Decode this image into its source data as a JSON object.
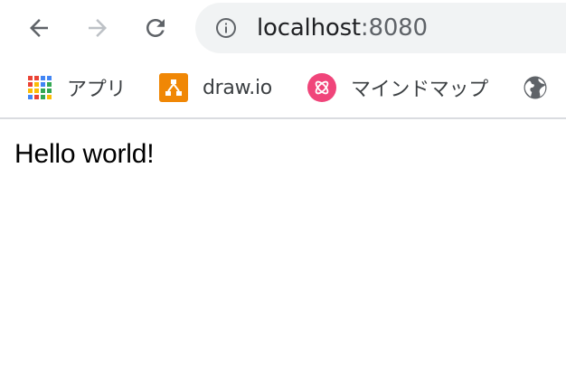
{
  "address_bar": {
    "host": "localhost",
    "port": ":8080"
  },
  "bookmarks": [
    {
      "label": "アプリ",
      "icon": "apps-grid-icon"
    },
    {
      "label": "draw.io",
      "icon": "drawio-icon"
    },
    {
      "label": "マインドマップ",
      "icon": "mindmap-icon"
    },
    {
      "label": "",
      "icon": "globe-icon"
    }
  ],
  "page": {
    "text": "Hello world!"
  },
  "colors": {
    "toolbar_icon": "#5f6368",
    "toolbar_icon_disabled": "#bdc1c6",
    "omnibox_bg": "#f1f3f4",
    "drawio": "#f08705",
    "mindmap": "#f0457a"
  }
}
